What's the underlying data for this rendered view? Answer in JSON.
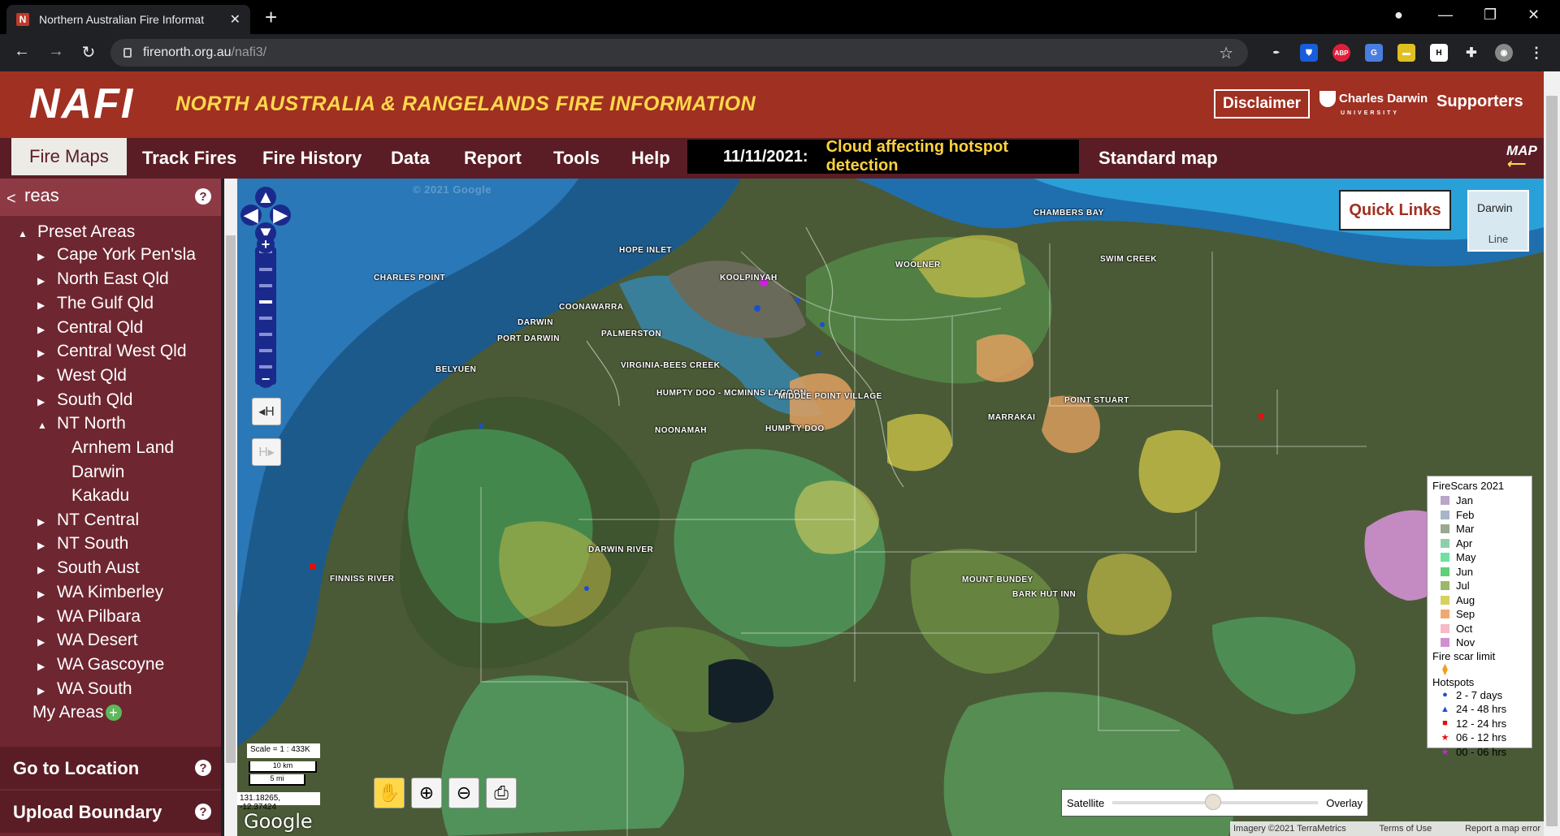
{
  "browser": {
    "tab_title": "Northern Australian Fire Informat",
    "favicon_letter": "N",
    "url_host": "firenorth.org.au",
    "url_path": "/nafi3/",
    "extensions": [
      "pin-icon",
      "bitwarden-icon",
      "abp-icon",
      "translate-icon",
      "notes-icon",
      "h-icon",
      "puzzle-icon",
      "profile-icon"
    ]
  },
  "header": {
    "logo": "NAFI",
    "subtitle": "NORTH AUSTRALIA & RANGELANDS FIRE INFORMATION",
    "disclaimer": "Disclaimer",
    "cdu_name": "Charles Darwin",
    "cdu_sub": "UNIVERSITY",
    "supporters": "Supporters"
  },
  "menu": {
    "items": [
      "Fire Maps",
      "Track Fires",
      "Fire History",
      "Data",
      "Report",
      "Tools",
      "Help"
    ],
    "active": "Fire Maps",
    "alert_date": "11/11/2021:",
    "alert_msg": "Cloud affecting hotspot detection",
    "standard_map": "Standard map",
    "map_icon": "MAP"
  },
  "sidebar": {
    "heading": "reas",
    "preset_areas": "Preset Areas",
    "items": [
      "Cape York Pen'sla",
      "North East Qld",
      "The Gulf Qld",
      "Central Qld",
      "Central West Qld",
      "West Qld",
      "South Qld",
      "NT North",
      "NT Central",
      "NT South",
      "South Aust",
      "WA Kimberley",
      "WA Pilbara",
      "WA Desert",
      "WA Gascoyne",
      "WA South"
    ],
    "nt_north_children": [
      "Arnhem Land",
      "Darwin",
      "Kakadu"
    ],
    "my_areas": "My Areas",
    "go_to_location": "Go to Location",
    "upload_boundary": "Upload Boundary"
  },
  "map": {
    "quick_links": "Quick Links",
    "inset_label": "Darwin",
    "inset_caption": "Line",
    "scale": "Scale = 1 : 433K",
    "scale_km": "10 km",
    "scale_mi": "5 mi",
    "coords": "131.18265, -12.37424",
    "google": "Google",
    "opacity_left": "Satellite",
    "opacity_right": "Overlay",
    "attribution": "Imagery ©2021 TerraMetrics",
    "terms": "Terms of Use",
    "report_error": "Report a map error",
    "places": [
      {
        "name": "CHAMBERS BAY"
      },
      {
        "name": "HOPE INLET"
      },
      {
        "name": "CHARLES POINT"
      },
      {
        "name": "KOOLPINYAH"
      },
      {
        "name": "WOOLNER"
      },
      {
        "name": "SWIM CREEK"
      },
      {
        "name": "COONAWARRA"
      },
      {
        "name": "DARWIN"
      },
      {
        "name": "PALMERSTON"
      },
      {
        "name": "PORT DARWIN"
      },
      {
        "name": "BELYUEN"
      },
      {
        "name": "VIRGINIA-BEES CREEK"
      },
      {
        "name": "HUMPTY DOO - MCMINNS LAGOON"
      },
      {
        "name": "MIDDLE POINT VILLAGE"
      },
      {
        "name": "POINT STUART"
      },
      {
        "name": "MARRAKAI"
      },
      {
        "name": "NOONAMAH"
      },
      {
        "name": "HUMPTY DOO"
      },
      {
        "name": "DARWIN RIVER"
      },
      {
        "name": "FINNISS RIVER"
      },
      {
        "name": "MOUNT BUNDEY"
      },
      {
        "name": "BARK HUT INN"
      }
    ],
    "watermark": "© 2021 Google"
  },
  "legend": {
    "title": "FireScars 2021",
    "months": [
      {
        "label": "Jan",
        "color": "#b9a6c8"
      },
      {
        "label": "Feb",
        "color": "#a8b4c8"
      },
      {
        "label": "Mar",
        "color": "#9aa88f"
      },
      {
        "label": "Apr",
        "color": "#8dd0a8"
      },
      {
        "label": "May",
        "color": "#6fe0a0"
      },
      {
        "label": "Jun",
        "color": "#5fd07a"
      },
      {
        "label": "Jul",
        "color": "#9ab86a"
      },
      {
        "label": "Aug",
        "color": "#d8d060"
      },
      {
        "label": "Sep",
        "color": "#f0a870"
      },
      {
        "label": "Oct",
        "color": "#f8b8c8"
      },
      {
        "label": "Nov",
        "color": "#d090d0"
      }
    ],
    "fire_scar_limit": "Fire scar limit",
    "hotspots_title": "Hotspots",
    "hotspots": [
      {
        "label": "2 - 7 days",
        "color": "#1a4fd0",
        "symbol": "●"
      },
      {
        "label": "24 - 48 hrs",
        "color": "#1a4fd0",
        "symbol": "▲"
      },
      {
        "label": "12 - 24 hrs",
        "color": "#e01010",
        "symbol": "■"
      },
      {
        "label": "06 - 12 hrs",
        "color": "#e01010",
        "symbol": "★"
      },
      {
        "label": "00 - 06 hrs",
        "color": "#d020e0",
        "symbol": "★"
      }
    ]
  }
}
